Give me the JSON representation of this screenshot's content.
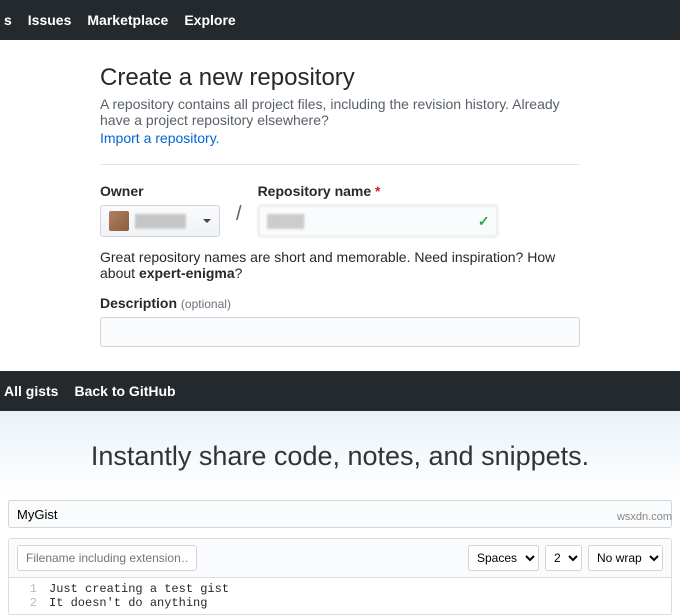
{
  "topnav": {
    "items": [
      "s",
      "Issues",
      "Marketplace",
      "Explore"
    ]
  },
  "repo": {
    "title": "Create a new repository",
    "subtitle": "A repository contains all project files, including the revision history. Already have a project repository elsewhere?",
    "import_link": "Import a repository.",
    "owner_label": "Owner",
    "owner_name": "██████",
    "slash": "/",
    "name_label": "Repository name",
    "name_value": "████",
    "suggest_prefix": "Great repository names are short and memorable. Need inspiration? How about ",
    "suggest_name": "expert-enigma",
    "suggest_suffix": "?",
    "desc_label": "Description",
    "optional": "(optional)"
  },
  "gistnav": {
    "all": "All gists",
    "back": "Back to GitHub"
  },
  "gist": {
    "hero": "Instantly share code, notes, and snippets.",
    "desc_value": "MyGist",
    "filename_placeholder": "Filename including extension…",
    "indent_mode": "Spaces",
    "indent_size": "2",
    "wrap": "No wrap",
    "lines": [
      {
        "n": "1",
        "t": "Just creating a test gist"
      },
      {
        "n": "2",
        "t": "It doesn't do anything"
      }
    ]
  },
  "watermark": "wsxdn.com"
}
